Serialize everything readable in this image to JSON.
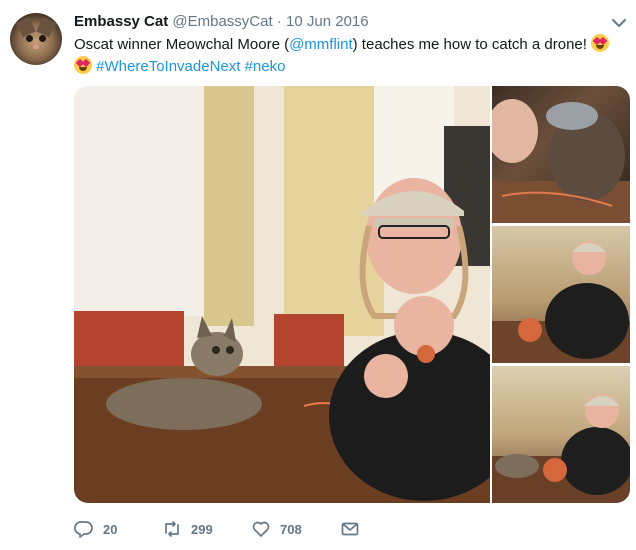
{
  "tweet": {
    "author_name": "Embassy Cat",
    "handle": "@EmbassyCat",
    "separator": "·",
    "date": "10 Jun 2016",
    "text_part1": "Oscat winner Meowchal Moore (",
    "mention": "@mmflint",
    "text_part2": ") teaches me how to catch a drone! ",
    "hashtag1": "#WhereToInvadeNext",
    "hashtag2": "#neko"
  },
  "stats": {
    "replies": "20",
    "retweets": "299",
    "likes": "708"
  },
  "icons": {
    "reply": "reply-icon",
    "retweet": "retweet-icon",
    "like": "heart-icon",
    "share": "envelope-icon",
    "menu": "chevron-down-icon",
    "emoji": "heart-eyes-emoji"
  },
  "colors": {
    "link": "#1b95e0",
    "secondary_text": "#657786",
    "primary_text": "#14171a"
  }
}
